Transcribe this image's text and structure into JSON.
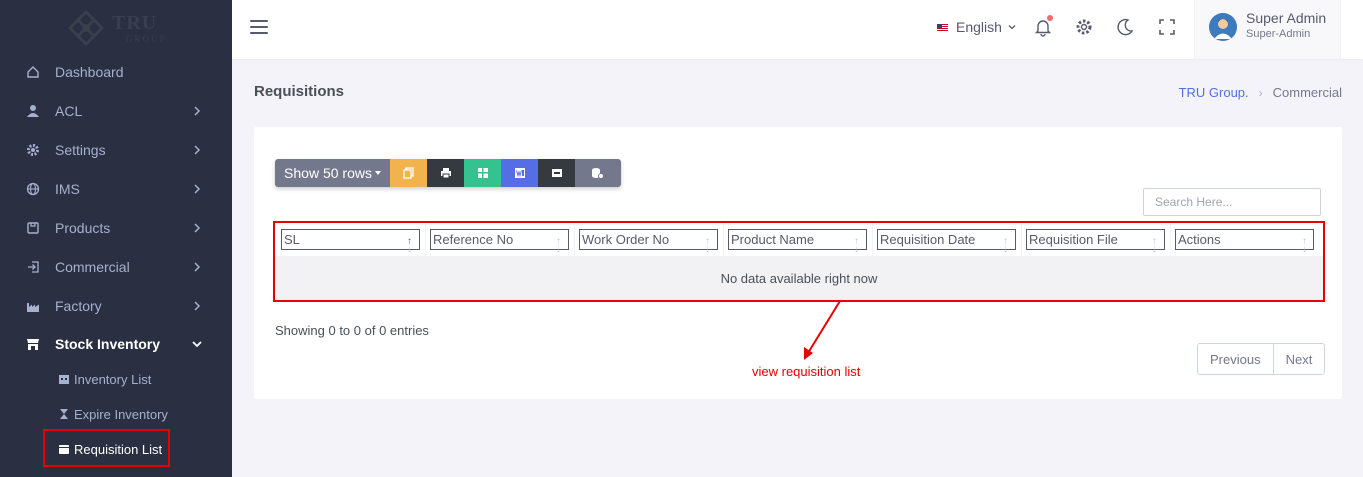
{
  "brand": {
    "name": "TRU",
    "sub": "GROUP"
  },
  "sidebar": {
    "items": [
      {
        "label": "Dashboard",
        "icon": "home-icon"
      },
      {
        "label": "ACL",
        "icon": "user-icon"
      },
      {
        "label": "Settings",
        "icon": "gear-icon"
      },
      {
        "label": "IMS",
        "icon": "globe-icon"
      },
      {
        "label": "Products",
        "icon": "box-icon"
      },
      {
        "label": "Commercial",
        "icon": "sign-in-icon"
      },
      {
        "label": "Factory",
        "icon": "factory-icon"
      },
      {
        "label": "Stock Inventory",
        "icon": "store-icon"
      }
    ],
    "subitems": [
      {
        "label": "Inventory List",
        "icon": "calendar-icon"
      },
      {
        "label": "Expire Inventory",
        "icon": "hourglass-icon"
      },
      {
        "label": "Requisition List",
        "icon": "folder-icon"
      }
    ]
  },
  "topbar": {
    "language": "English",
    "user_name": "Super Admin",
    "user_role": "Super-Admin"
  },
  "page": {
    "title": "Requisitions",
    "breadcrumb": [
      "TRU Group.",
      "Commercial"
    ]
  },
  "toolbar": {
    "show_rows": "Show 50 rows"
  },
  "search": {
    "placeholder": "Search Here..."
  },
  "table": {
    "columns": [
      "SL",
      "Reference No",
      "Work Order No",
      "Product Name",
      "Requisition Date",
      "Requisition File",
      "Actions"
    ],
    "empty_message": "No data available right now"
  },
  "footer": {
    "showing": "Showing 0 to 0 of 0 entries",
    "previous": "Previous",
    "next": "Next"
  },
  "annotation": {
    "text": "view requisition list",
    "color": "#e80000"
  },
  "colors": {
    "sidebar_bg": "#2a3042",
    "accent": "#556ee6",
    "highlight": "#e80000"
  }
}
